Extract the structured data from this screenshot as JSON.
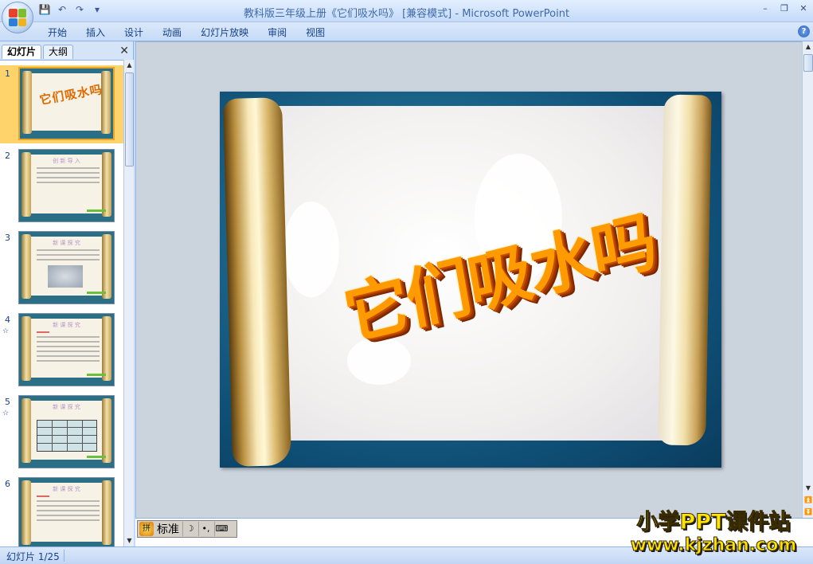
{
  "window": {
    "title": "教科版三年级上册《它们吸水吗》 [兼容模式]",
    "app_name": "Microsoft PowerPoint",
    "title_separator": " - "
  },
  "quick_access": {
    "icons": [
      "save-icon",
      "undo-icon",
      "redo-icon",
      "customize-icon"
    ],
    "glyphs": [
      "💾",
      "↶",
      "↷",
      "▾"
    ]
  },
  "window_controls": {
    "minimize": "–",
    "restore": "❐",
    "close": "✕"
  },
  "ribbon": {
    "tabs": [
      "开始",
      "插入",
      "设计",
      "动画",
      "幻灯片放映",
      "审阅",
      "视图"
    ],
    "help": "?"
  },
  "left_pane": {
    "tabs": {
      "slides": "幻灯片",
      "outline": "大纲"
    },
    "close": "✕",
    "thumbnails": [
      {
        "num": "1",
        "sub": "",
        "title": "它们吸水吗",
        "kind": "title"
      },
      {
        "num": "2",
        "sub": "",
        "heading": "创 新 导 入",
        "kind": "text"
      },
      {
        "num": "3",
        "sub": "",
        "heading": "新 课 探 究",
        "kind": "photo"
      },
      {
        "num": "4",
        "sub": "☆",
        "heading": "新 课 探 究",
        "kind": "list"
      },
      {
        "num": "5",
        "sub": "☆",
        "heading": "新 课 探 究",
        "kind": "table"
      },
      {
        "num": "6",
        "sub": "",
        "heading": "新 课 探 究",
        "kind": "list"
      }
    ]
  },
  "slide": {
    "title": "它们吸水吗"
  },
  "ime": {
    "logo": "拼",
    "mode": "标准",
    "moon": "☽",
    "punct": "•,",
    "keyboard": "⌨"
  },
  "watermark": {
    "line1": "小学PPT课件站",
    "line2": "www.kjzhan.com"
  },
  "status": {
    "slide_info": "幻灯片 1/25"
  },
  "colors": {
    "accent": "#15428b",
    "selected_thumb": "#ffd36b",
    "title_orange": "#ff9a00"
  }
}
